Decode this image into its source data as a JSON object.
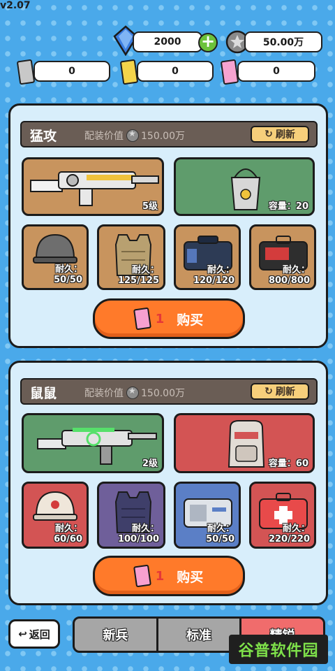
{
  "version": "v2.07",
  "resources": {
    "gems": "2000",
    "coins": "50.00万",
    "ticket_silver": "0",
    "ticket_gold": "0",
    "ticket_pink": "0"
  },
  "panels": [
    {
      "title": "猛攻",
      "value_label": "配装价值",
      "value": "150.00万",
      "refresh_label": "刷新",
      "weapon_level": "5级",
      "backpack_capacity": "容量：20",
      "gear": [
        {
          "name": "helmet",
          "label": "耐久：",
          "value": "50/50"
        },
        {
          "name": "vest",
          "label": "耐久：",
          "value": "125/125"
        },
        {
          "name": "bag",
          "label": "耐久：",
          "value": "120/120"
        },
        {
          "name": "case",
          "label": "耐久：",
          "value": "800/800"
        }
      ],
      "buy_count": "1",
      "buy_label": "购买"
    },
    {
      "title": "鼠鼠",
      "value_label": "配装价值",
      "value": "150.00万",
      "refresh_label": "刷新",
      "weapon_level": "2级",
      "backpack_capacity": "容量：60",
      "gear": [
        {
          "name": "helmet",
          "label": "耐久：",
          "value": "60/60"
        },
        {
          "name": "vest",
          "label": "耐久：",
          "value": "100/100"
        },
        {
          "name": "case",
          "label": "耐久：",
          "value": "50/50"
        },
        {
          "name": "medkit",
          "label": "耐久：",
          "value": "220/220"
        }
      ],
      "buy_count": "1",
      "buy_label": "购买"
    }
  ],
  "bottom": {
    "back_label": "返回",
    "tabs": [
      "新兵",
      "标准",
      "精锐"
    ]
  },
  "watermark": "谷普软件园",
  "colors": {
    "background": "#4aa9ea",
    "buy_button": "#ff7a2a",
    "refresh_button": "#f6cf7b",
    "panel_header": "#6a5d55"
  }
}
